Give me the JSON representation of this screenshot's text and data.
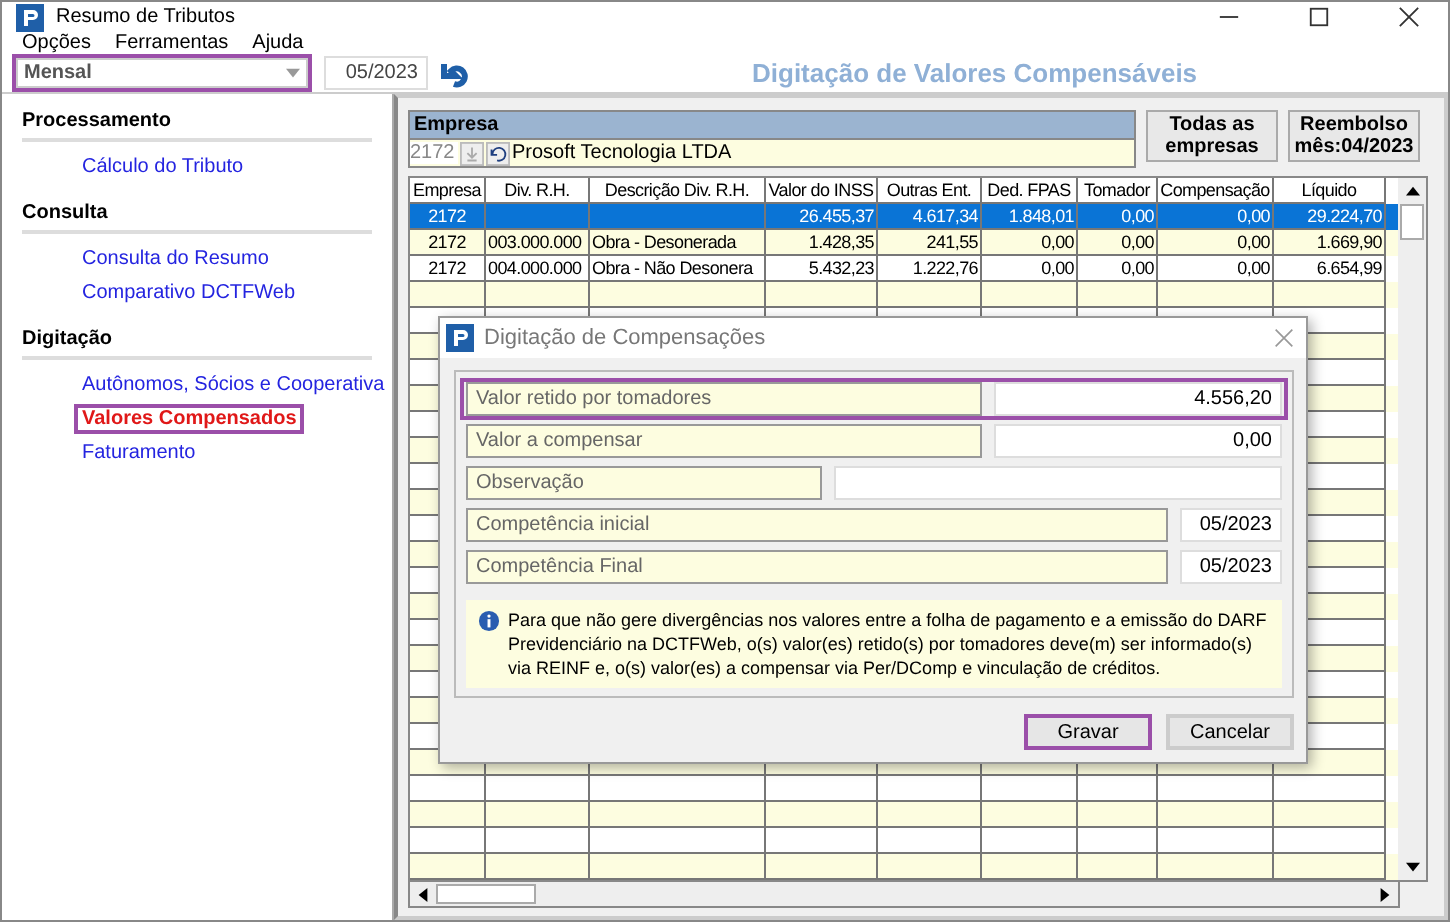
{
  "window": {
    "title": "Resumo de Tributos"
  },
  "menu": [
    {
      "label": "Opções"
    },
    {
      "label": "Ferramentas"
    },
    {
      "label": "Ajuda"
    }
  ],
  "toolbar": {
    "period": "Mensal",
    "period_highlighted": true,
    "competence": "05/2023"
  },
  "header_title": "Digitação de Valores Compensáveis",
  "sidebar": {
    "sections": [
      {
        "title": "Processamento",
        "items": [
          {
            "label": "Cálculo do Tributo",
            "selected": false,
            "highlighted": false
          }
        ]
      },
      {
        "title": "Consulta",
        "items": [
          {
            "label": "Consulta do Resumo",
            "selected": false,
            "highlighted": false
          },
          {
            "label": "Comparativo DCTFWeb",
            "selected": false,
            "highlighted": false
          }
        ]
      },
      {
        "title": "Digitação",
        "items": [
          {
            "label": "Autônomos, Sócios e Cooperativa",
            "selected": false,
            "highlighted": false
          },
          {
            "label": "Valores Compensados",
            "selected": true,
            "highlighted": true
          },
          {
            "label": "Faturamento",
            "selected": false,
            "highlighted": false
          }
        ]
      }
    ]
  },
  "company": {
    "heading": "Empresa",
    "code": "2172",
    "name": "Prosoft Tecnologia LTDA"
  },
  "side_buttons": [
    {
      "label": "Todas as empresas"
    },
    {
      "label": "Reembolso mês:04/2023"
    }
  ],
  "table": {
    "columns": [
      "Empresa",
      "Div. R.H.",
      "Descrição Div. R.H.",
      "Valor do INSS",
      "Outras Ent.",
      "Ded. FPAS",
      "Tomador",
      "Compensação",
      "Líquido"
    ],
    "rows": [
      {
        "selected": true,
        "cells": [
          "2172",
          "",
          "",
          "26.455,37",
          "4.617,34",
          "1.848,01",
          "0,00",
          "0,00",
          "29.224,70"
        ]
      },
      {
        "selected": false,
        "cells": [
          "2172",
          "003.000.000",
          "Obra - Desonerada",
          "1.428,35",
          "241,55",
          "0,00",
          "0,00",
          "0,00",
          "1.669,90"
        ]
      },
      {
        "selected": false,
        "cells": [
          "2172",
          "004.000.000",
          "Obra - Não Desonera",
          "5.432,23",
          "1.222,76",
          "0,00",
          "0,00",
          "0,00",
          "6.654,99"
        ]
      }
    ]
  },
  "dialog": {
    "title": "Digitação de Compensações",
    "fields": [
      {
        "kind": "amount",
        "label": "Valor retido por tomadores",
        "value": "4.556,20",
        "highlighted": true
      },
      {
        "kind": "amount",
        "label": "Valor a compensar",
        "value": "0,00",
        "highlighted": false
      },
      {
        "kind": "text",
        "label": "Observação",
        "highlighted": false
      },
      {
        "kind": "date",
        "label": "Competência inicial",
        "value": "05/2023",
        "highlighted": false
      },
      {
        "kind": "date",
        "label": "Competência Final",
        "value": "05/2023",
        "highlighted": false
      }
    ],
    "note": "Para que não gere divergências nos valores entre a folha de pagamento e a emissão do DARF Previdenciário na DCTFWeb, o(s) valor(es) retido(s) por tomadores deve(m) ser informado(s) via REINF e, o(s) valor(es) a compensar via Per/DComp e vinculação de créditos.",
    "buttons": [
      {
        "label": "Gravar",
        "highlighted": true
      },
      {
        "label": "Cancelar",
        "highlighted": false
      }
    ]
  }
}
